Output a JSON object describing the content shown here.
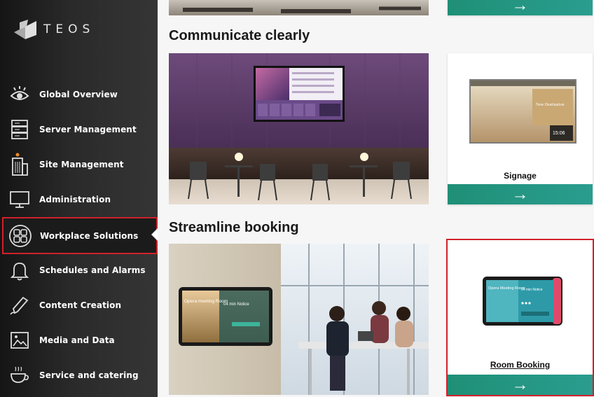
{
  "brand": {
    "name": "TEOS"
  },
  "sidebar": {
    "items": [
      {
        "label": "Global Overview",
        "icon": "eye-icon"
      },
      {
        "label": "Server Management",
        "icon": "server-icon"
      },
      {
        "label": "Site Management",
        "icon": "building-icon"
      },
      {
        "label": "Administration",
        "icon": "monitor-icon"
      },
      {
        "label": "Workplace Solutions",
        "icon": "workplace-grid-icon",
        "active": true
      },
      {
        "label": "Schedules and Alarms",
        "icon": "bell-icon"
      },
      {
        "label": "Content Creation",
        "icon": "pencil-icon"
      },
      {
        "label": "Media and Data",
        "icon": "image-icon"
      },
      {
        "label": "Service and catering",
        "icon": "cup-icon"
      }
    ]
  },
  "main": {
    "sections": [
      {
        "title": "Communicate clearly"
      },
      {
        "title": "Streamline booking"
      }
    ],
    "cards": [
      {
        "label": "Signage",
        "arrow": "→"
      },
      {
        "label": "Room Booking",
        "arrow": "→"
      },
      {
        "label": "",
        "arrow": "→"
      }
    ],
    "screens": {
      "signage_screen_text": "New Destination",
      "signage_time": "15:06",
      "booking_title": "Opera Meeting Room",
      "booking_free": "04 min Notice",
      "room_booking_left": "Opera meeting Room",
      "room_booking_right": "04 min Notice"
    }
  },
  "colors": {
    "accent": "#2a9d8f",
    "highlight": "#d0212b",
    "sidebar": "#2a2a2a"
  }
}
